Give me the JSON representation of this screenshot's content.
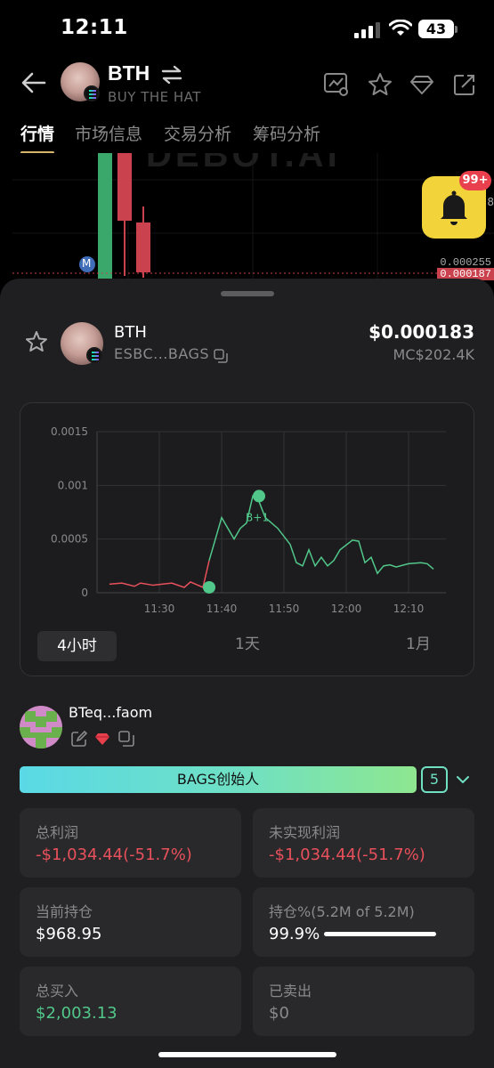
{
  "status_bar": {
    "time": "12:11",
    "battery": "43"
  },
  "header": {
    "title": "BTH",
    "subtitle": "BUY THE HAT"
  },
  "tabs": [
    {
      "label": "行情",
      "active": true
    },
    {
      "label": "市场信息",
      "active": false
    },
    {
      "label": "交易分析",
      "active": false
    },
    {
      "label": "筹码分析",
      "active": false
    }
  ],
  "background_chart": {
    "watermark": "DEBOT.AI",
    "marker_label": "M",
    "price_label_1": "0.000255",
    "price_label_2": "0.000187",
    "axis_fragment": "8",
    "colors": {
      "up": "#3aa86b",
      "down": "#c9424d"
    }
  },
  "notification": {
    "badge": "99+"
  },
  "token": {
    "name": "BTH",
    "address": "ESBC...BAGS",
    "price": "$0.000183",
    "market_cap": "MC$202.4K"
  },
  "chart_data": {
    "type": "line",
    "title": "",
    "xlabel": "",
    "ylabel": "",
    "x_ticks": [
      "11:30",
      "11:40",
      "11:50",
      "12:00",
      "12:10"
    ],
    "y_ticks": [
      "0",
      "0.0005",
      "0.001",
      "0.0015"
    ],
    "ylim": [
      0,
      0.0015
    ],
    "x_minutes": [
      -8,
      -6,
      -4,
      -3,
      -1,
      2,
      4,
      5,
      7,
      8,
      9,
      10,
      11,
      12,
      13,
      14,
      15,
      16,
      17,
      19,
      21,
      22,
      23,
      24,
      25,
      26,
      27,
      28,
      29,
      31,
      32,
      33,
      34,
      35,
      36,
      37,
      38,
      40,
      42,
      43,
      44
    ],
    "x_origin_label": "11:30",
    "values": [
      8e-05,
      9e-05,
      6e-05,
      9e-05,
      7e-05,
      9e-05,
      5e-05,
      0.0001,
      5e-05,
      0.0003,
      0.0005,
      0.0007,
      0.0006,
      0.0005,
      0.0006,
      0.00065,
      0.0009,
      0.00085,
      0.0007,
      0.0006,
      0.00045,
      0.00028,
      0.00025,
      0.0004,
      0.00025,
      0.00033,
      0.00025,
      0.0003,
      0.0004,
      0.00049,
      0.00048,
      0.00028,
      0.00033,
      0.00018,
      0.00025,
      0.00026,
      0.00024,
      0.00027,
      0.00028,
      0.00027,
      0.00022
    ],
    "markers": [
      {
        "x_minute": 8,
        "value": 5e-05,
        "label": ""
      },
      {
        "x_minute": 16,
        "value": 0.0009,
        "label": "B+1"
      }
    ],
    "line_color": "#51c78a",
    "pre_color": "#e8505b",
    "grid": true
  },
  "ranges": [
    {
      "label": "4小时",
      "active": true
    },
    {
      "label": "1天",
      "active": false
    },
    {
      "label": "1月",
      "active": false
    }
  ],
  "wallet": {
    "name": "BTeq...faom",
    "tag": "BAGS创始人",
    "count": "5"
  },
  "stats": {
    "total_profit_label": "总利润",
    "total_profit_value": "-$1,034.44(-51.7%)",
    "unrealized_label": "未实现利润",
    "unrealized_value": "-$1,034.44(-51.7%)",
    "holding_label": "当前持仓",
    "holding_value": "$968.95",
    "holding_pct_label": "持仓%(5.2M of 5.2M)",
    "holding_pct_value": "99.9%",
    "holding_pct_fraction": 0.999,
    "bought_label": "总买入",
    "bought_value": "$2,003.13",
    "sold_label": "已卖出",
    "sold_value": "$0"
  }
}
